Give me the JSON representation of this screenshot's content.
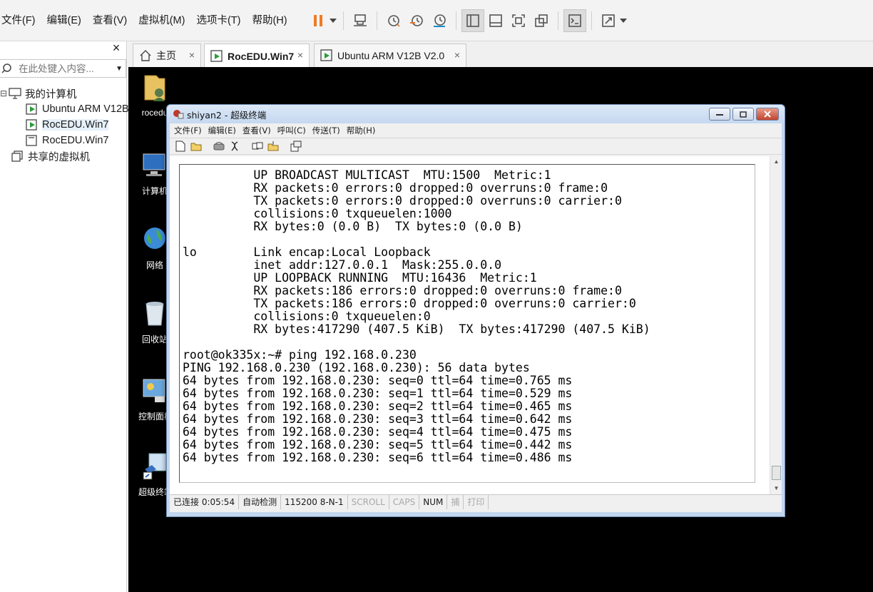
{
  "menubar": {
    "items": [
      "文件(F)",
      "编辑(E)",
      "查看(V)",
      "虚拟机(M)",
      "选项卡(T)",
      "帮助(H)"
    ]
  },
  "toolbar": {
    "icons": [
      "pause-icon",
      "send-keys-icon",
      "snapshot-icon",
      "revert-snapshot-icon",
      "snapshot-manager-icon",
      "library-view-icon",
      "thumbnail-bar-icon",
      "fullscreen-icon",
      "unity-icon",
      "console-view-icon",
      "stretch-icon"
    ],
    "accent": "#f07b22"
  },
  "sidebar": {
    "close_label": "×",
    "search_placeholder": "在此处键入内容...",
    "tree": {
      "root_label": "我的计算机",
      "children": [
        "Ubuntu ARM V12B V2.0",
        "RocEDU.Win7",
        "RocEDU.Win7"
      ],
      "shared_label": "共享的虚拟机"
    }
  },
  "tabs": [
    {
      "label": "主页",
      "close": "×"
    },
    {
      "label": "RocEDU.Win7",
      "close": "×"
    },
    {
      "label": "Ubuntu ARM V12B V2.0",
      "close": "×"
    }
  ],
  "desktop": {
    "icons": [
      "rocedu",
      "计算机",
      "网络",
      "回收站",
      "控制面板",
      "超级终端"
    ]
  },
  "hyperterminal": {
    "title": "shiyan2 - 超级终端",
    "menu": [
      "文件(F)",
      "编辑(E)",
      "查看(V)",
      "呼叫(C)",
      "传送(T)",
      "帮助(H)"
    ],
    "lines": [
      "          UP BROADCAST MULTICAST  MTU:1500  Metric:1",
      "          RX packets:0 errors:0 dropped:0 overruns:0 frame:0",
      "          TX packets:0 errors:0 dropped:0 overruns:0 carrier:0",
      "          collisions:0 txqueuelen:1000",
      "          RX bytes:0 (0.0 B)  TX bytes:0 (0.0 B)",
      "",
      "lo        Link encap:Local Loopback",
      "          inet addr:127.0.0.1  Mask:255.0.0.0",
      "          UP LOOPBACK RUNNING  MTU:16436  Metric:1",
      "          RX packets:186 errors:0 dropped:0 overruns:0 frame:0",
      "          TX packets:186 errors:0 dropped:0 overruns:0 carrier:0",
      "          collisions:0 txqueuelen:0",
      "          RX bytes:417290 (407.5 KiB)  TX bytes:417290 (407.5 KiB)",
      "",
      "root@ok335x:~# ping 192.168.0.230",
      "PING 192.168.0.230 (192.168.0.230): 56 data bytes",
      "64 bytes from 192.168.0.230: seq=0 ttl=64 time=0.765 ms",
      "64 bytes from 192.168.0.230: seq=1 ttl=64 time=0.529 ms",
      "64 bytes from 192.168.0.230: seq=2 ttl=64 time=0.465 ms",
      "64 bytes from 192.168.0.230: seq=3 ttl=64 time=0.642 ms",
      "64 bytes from 192.168.0.230: seq=4 ttl=64 time=0.475 ms",
      "64 bytes from 192.168.0.230: seq=5 ttl=64 time=0.442 ms",
      "64 bytes from 192.168.0.230: seq=6 ttl=64 time=0.486 ms"
    ],
    "status": {
      "connected": "已连接 0:05:54",
      "detect": "自动检测",
      "port": "115200 8-N-1",
      "scroll": "SCROLL",
      "caps": "CAPS",
      "num": "NUM",
      "capture": "捕",
      "print": "打印"
    }
  }
}
